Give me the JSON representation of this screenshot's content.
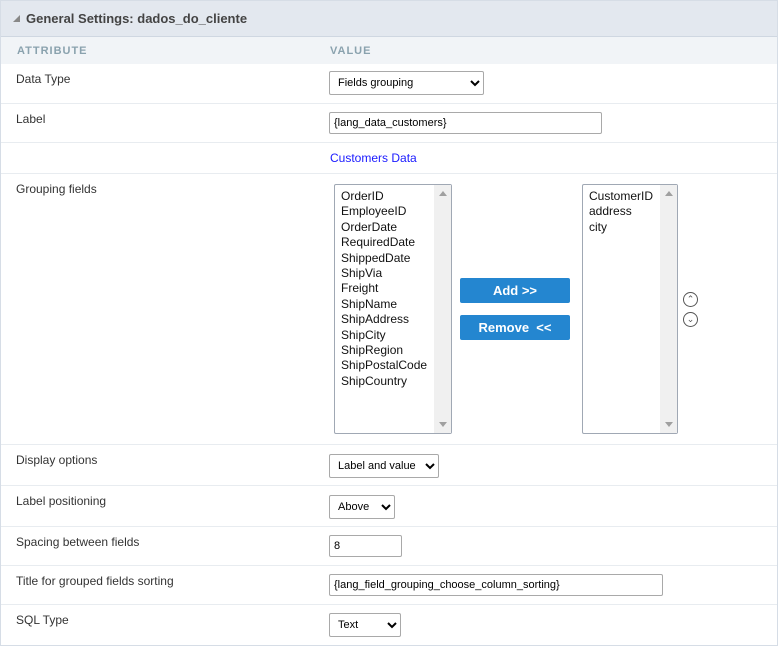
{
  "header": {
    "title": "General Settings: dados_do_cliente"
  },
  "columns": {
    "attribute": "ATTRIBUTE",
    "value": "VALUE"
  },
  "rows": {
    "data_type": {
      "label": "Data Type",
      "value": "Fields grouping"
    },
    "label": {
      "label": "Label",
      "value": "{lang_data_customers}"
    },
    "preview": {
      "value": "Customers Data"
    },
    "grouping": {
      "label": "Grouping fields",
      "available": [
        "OrderID",
        "EmployeeID",
        "OrderDate",
        "RequiredDate",
        "ShippedDate",
        "ShipVia",
        "Freight",
        "ShipName",
        "ShipAddress",
        "ShipCity",
        "ShipRegion",
        "ShipPostalCode",
        "ShipCountry"
      ],
      "selected": [
        "CustomerID",
        "address",
        "city"
      ],
      "add_label": "Add >>",
      "remove_label": "Remove  <<"
    },
    "display_options": {
      "label": "Display options",
      "value": "Label and value"
    },
    "label_positioning": {
      "label": "Label positioning",
      "value": "Above"
    },
    "spacing": {
      "label": "Spacing between fields",
      "value": "8"
    },
    "sort_title": {
      "label": "Title for grouped fields sorting",
      "value": "{lang_field_grouping_choose_column_sorting}"
    },
    "sql_type": {
      "label": "SQL Type",
      "value": "Text"
    }
  }
}
